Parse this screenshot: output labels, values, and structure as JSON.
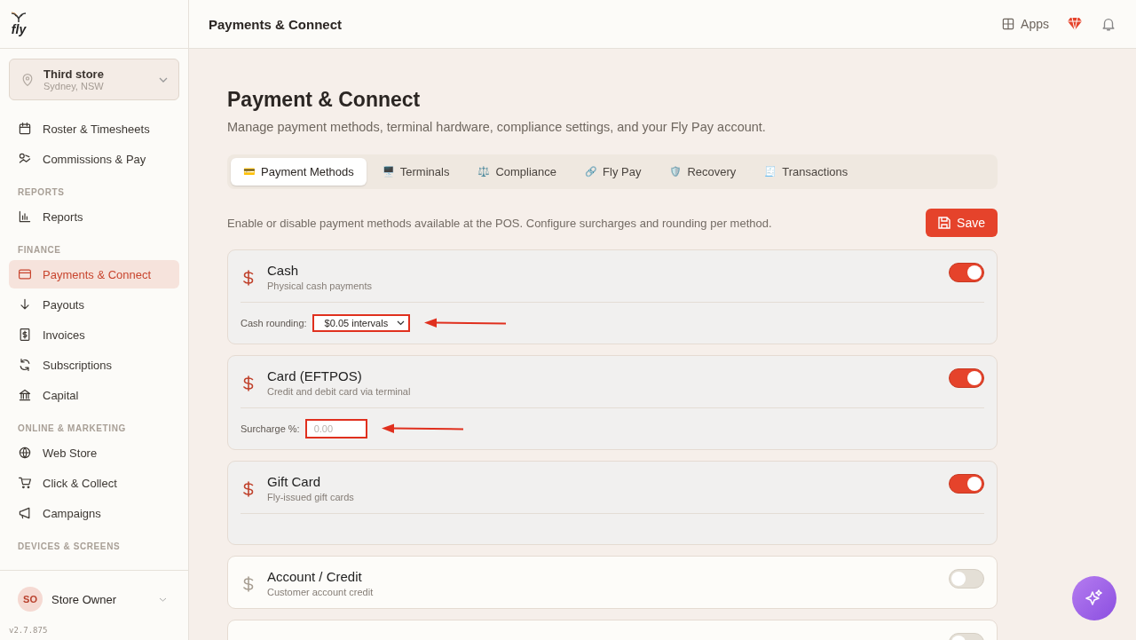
{
  "sidebar": {
    "logo": "fly",
    "store": {
      "name": "Third store",
      "location": "Sydney, NSW"
    },
    "sections": [
      {
        "items": [
          {
            "label": "Roster & Timesheets",
            "selected": false
          },
          {
            "label": "Commissions & Pay",
            "selected": false
          }
        ]
      },
      {
        "heading": "REPORTS",
        "items": [
          {
            "label": "Reports",
            "selected": false
          }
        ]
      },
      {
        "heading": "FINANCE",
        "items": [
          {
            "label": "Payments & Connect",
            "selected": true
          },
          {
            "label": "Payouts",
            "selected": false
          },
          {
            "label": "Invoices",
            "selected": false
          },
          {
            "label": "Subscriptions",
            "selected": false
          },
          {
            "label": "Capital",
            "selected": false
          }
        ]
      },
      {
        "heading": "ONLINE & MARKETING",
        "items": [
          {
            "label": "Web Store",
            "selected": false
          },
          {
            "label": "Click & Collect",
            "selected": false
          },
          {
            "label": "Campaigns",
            "selected": false
          }
        ]
      },
      {
        "heading": "DEVICES & SCREENS"
      }
    ],
    "user": {
      "initials": "SO",
      "name": "Store Owner"
    },
    "version": "v2.7.875"
  },
  "header": {
    "title": "Payments & Connect",
    "apps": "Apps"
  },
  "page": {
    "title": "Payment & Connect",
    "subtitle": "Manage payment methods, terminal hardware, compliance settings, and your Fly Pay account.",
    "tabs": [
      {
        "icon": "💳",
        "label": "Payment Methods",
        "selected": true
      },
      {
        "icon": "🖥️",
        "label": "Terminals",
        "selected": false
      },
      {
        "icon": "⚖️",
        "label": "Compliance",
        "selected": false
      },
      {
        "icon": "🔗",
        "label": "Fly Pay",
        "selected": false
      },
      {
        "icon": "🛡️",
        "label": "Recovery",
        "selected": false
      },
      {
        "icon": "🧾",
        "label": "Transactions",
        "selected": false
      }
    ],
    "description": "Enable or disable payment methods available at the POS. Configure surcharges and rounding per method.",
    "save": "Save",
    "methods": [
      {
        "name": "Cash",
        "detail": "Physical cash payments",
        "enabled": true,
        "setting": {
          "kind": "select",
          "label": "Cash rounding:",
          "value": "$0.05 intervals",
          "annotated": true
        }
      },
      {
        "name": "Card (EFTPOS)",
        "detail": "Credit and debit card via terminal",
        "enabled": true,
        "setting": {
          "kind": "input",
          "label": "Surcharge %:",
          "placeholder": "0.00",
          "annotated": true
        }
      },
      {
        "name": "Gift Card",
        "detail": "Fly-issued gift cards",
        "enabled": true,
        "setting": {
          "kind": "empty"
        }
      },
      {
        "name": "Account / Credit",
        "detail": "Customer account credit",
        "enabled": false
      },
      {
        "enabled": false
      }
    ]
  }
}
